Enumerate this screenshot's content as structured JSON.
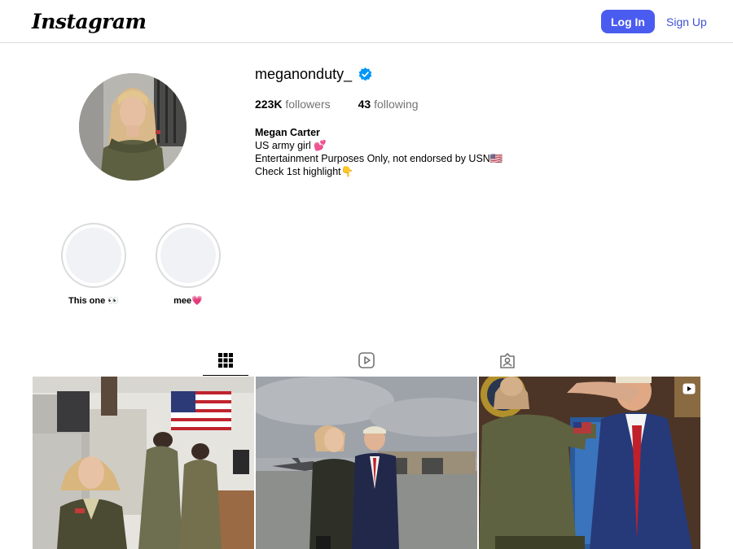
{
  "header": {
    "logo": "Instagram",
    "login_label": "Log In",
    "signup_label": "Sign Up"
  },
  "profile": {
    "username": "meganonduty_",
    "verified": true,
    "followers_count": "223K",
    "followers_label": "followers",
    "following_count": "43",
    "following_label": "following",
    "full_name": "Megan Carter",
    "bio_lines": [
      "US army girl 💕",
      "Entertainment Purposes Only, not endorsed by USN🇺🇸",
      "Check 1st highlight👇"
    ]
  },
  "highlights": [
    {
      "label": "This one 👀"
    },
    {
      "label": "mee💗"
    }
  ],
  "tabs": [
    {
      "icon": "grid-icon",
      "active": true
    },
    {
      "icon": "reels-icon",
      "active": false
    },
    {
      "icon": "tagged-icon",
      "active": false
    }
  ],
  "posts": [
    {
      "icon": "photo-post-1"
    },
    {
      "icon": "photo-post-2"
    },
    {
      "icon": "photo-post-3",
      "badge": "reel-icon"
    }
  ],
  "colors": {
    "accent": "#4a5cf0",
    "link": "#3f51d6",
    "verified": "#0095f6",
    "muted": "#737373",
    "border": "#dbdbdb"
  }
}
